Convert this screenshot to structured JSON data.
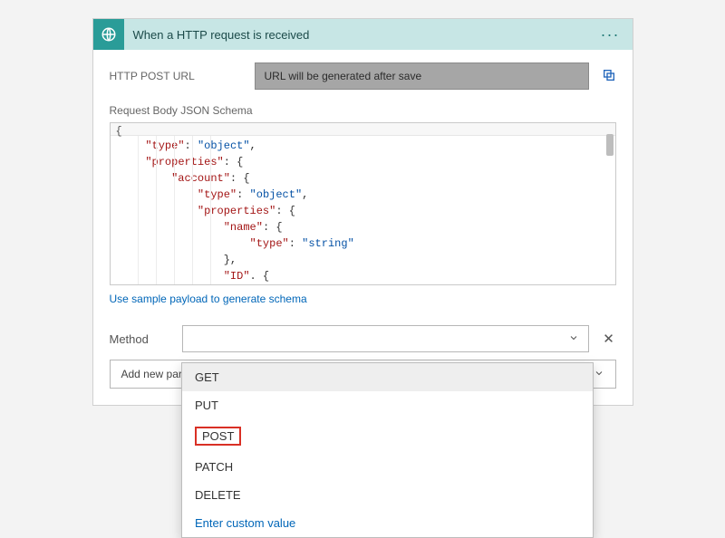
{
  "header": {
    "title": "When a HTTP request is received"
  },
  "postUrl": {
    "label": "HTTP POST URL",
    "value": "URL will be generated after save"
  },
  "schema": {
    "label": "Request Body JSON Schema",
    "open_brace": "{",
    "l1a": "\"type\"",
    "l1b": ": ",
    "l1c": "\"object\"",
    "l1d": ",",
    "l2a": "\"properties\"",
    "l2b": ": {",
    "l3a": "\"account\"",
    "l3b": ": {",
    "l4a": "\"type\"",
    "l4b": ": ",
    "l4c": "\"object\"",
    "l4d": ",",
    "l5a": "\"properties\"",
    "l5b": ": {",
    "l6a": "\"name\"",
    "l6b": ": {",
    "l7a": "\"type\"",
    "l7b": ": ",
    "l7c": "\"string\"",
    "l8a": "},",
    "l9a": "\"ID\"",
    "l9b": ". {"
  },
  "sampleLink": "Use sample payload to generate schema",
  "method": {
    "label": "Method",
    "options": [
      "GET",
      "PUT",
      "POST",
      "PATCH",
      "DELETE"
    ],
    "customLabel": "Enter custom value"
  },
  "addParam": {
    "label": "Add new parameter"
  }
}
